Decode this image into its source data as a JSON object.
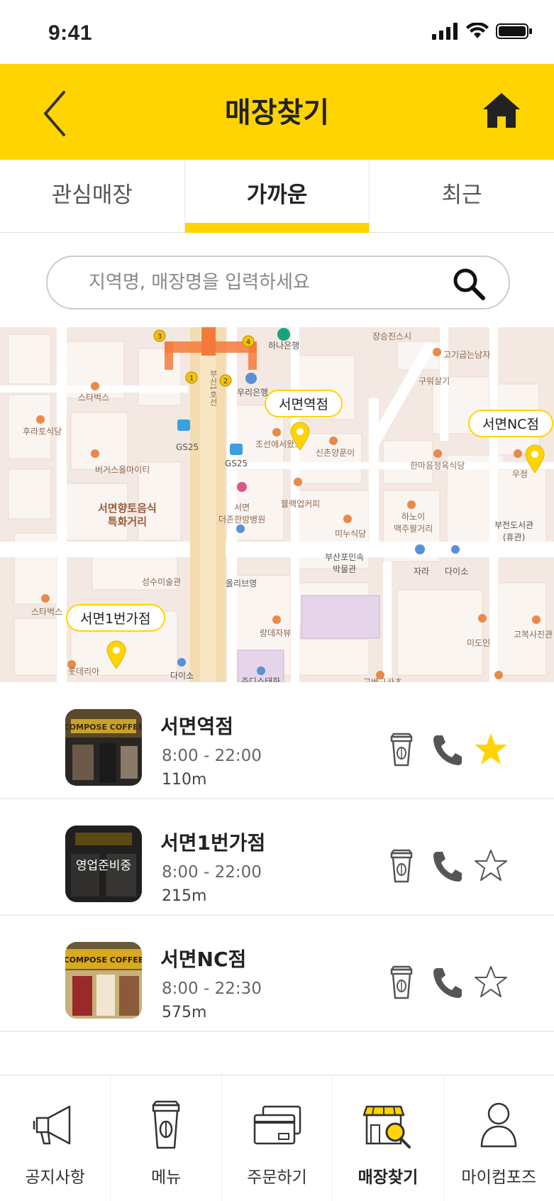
{
  "status_bar": {
    "time": "9:41"
  },
  "header": {
    "title": "매장찾기",
    "back_icon": "chevron-left-icon",
    "home_icon": "home-icon",
    "accent_color": "#FFD400"
  },
  "tabs": [
    {
      "label": "관심매장",
      "active": false
    },
    {
      "label": "가까운",
      "active": true
    },
    {
      "label": "최근",
      "active": false
    }
  ],
  "search": {
    "placeholder": "지역명, 매장명을 입력하세요",
    "value": ""
  },
  "map": {
    "pins": [
      {
        "label": "서면역점"
      },
      {
        "label": "서면NC점"
      },
      {
        "label": "서면1번가점"
      }
    ],
    "pois": {
      "p1": "장승진스시",
      "p2": "하나은행",
      "p3": "고기굽는남자",
      "p4": "스타벅스",
      "p5": "우리은행",
      "p6": "구워살기",
      "p7": "후라토식당",
      "p8": "GS25",
      "p9": "GS25",
      "p10": "조선에서왔소",
      "p11": "신촌양푼이",
      "p12": "한마음정육식당",
      "p13": "우정",
      "p14": "버거스올마이티",
      "p15": "서면향토음식\n특화거리",
      "p16": "서면\n더존한방병원",
      "p17": "블랙업커피",
      "p18": "하노이\n맥주팔거리",
      "p19": "부전도서관\n(휴관)",
      "p20": "미누식당",
      "p21": "부산포민속\n박물관",
      "p22": "자라",
      "p23": "다이소",
      "p24": "성수미술관",
      "p25": "올리브영",
      "p26": "스타벅스",
      "p27": "랑데자뷰",
      "p28": "미도인",
      "p29": "고복사진관",
      "p30": "롯데리아",
      "p31": "다이소",
      "p32": "쥬디스태화",
      "p33": "고베규카츠",
      "p34": "부산1호선"
    }
  },
  "stores": [
    {
      "name": "서면역점",
      "hours": "8:00 - 22:00",
      "distance": "110m",
      "favorite": true,
      "status": ""
    },
    {
      "name": "서면1번가점",
      "hours": "8:00 - 22:00",
      "distance": "215m",
      "favorite": false,
      "status": "영업준비중"
    },
    {
      "name": "서면NC점",
      "hours": "8:00 - 22:30",
      "distance": "575m",
      "favorite": false,
      "status": ""
    }
  ],
  "bottom_nav": [
    {
      "label": "공지사항",
      "icon": "megaphone-icon",
      "active": false
    },
    {
      "label": "메뉴",
      "icon": "coffee-cup-icon",
      "active": false
    },
    {
      "label": "주문하기",
      "icon": "card-icon",
      "active": false
    },
    {
      "label": "매장찾기",
      "icon": "store-search-icon",
      "active": true
    },
    {
      "label": "마이컴포즈",
      "icon": "person-icon",
      "active": false
    }
  ]
}
